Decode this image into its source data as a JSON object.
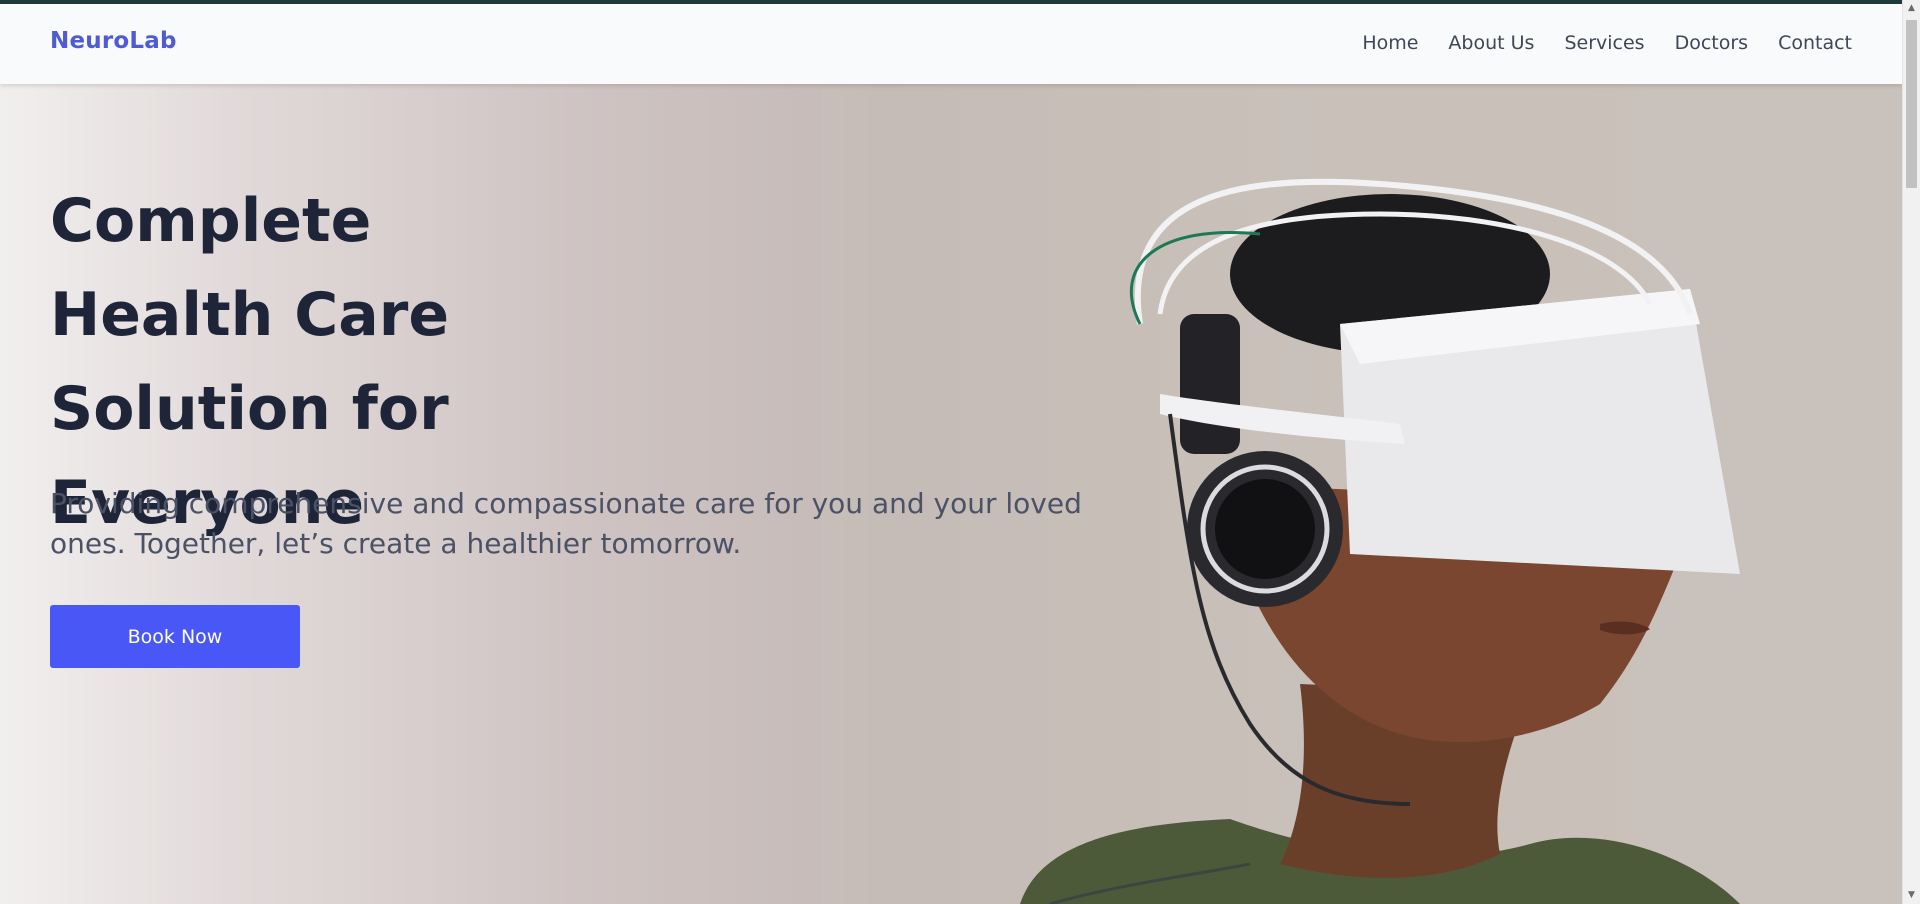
{
  "brand": "NeuroLab",
  "nav": {
    "items": [
      "Home",
      "About Us",
      "Services",
      "Doctors",
      "Contact"
    ]
  },
  "hero": {
    "title": "Complete Health Care Solution for Everyone",
    "subtitle": "Providing comprehensive and compassionate care for you and your loved ones. Together, let’s create a healthier tomorrow.",
    "cta_label": "Book Now",
    "image_subject": "person wearing neuro headset"
  },
  "colors": {
    "brand": "#4f5bd5",
    "cta": "#4a57f7",
    "heading": "#1e2538",
    "top_strip": "#1f3a3a"
  }
}
